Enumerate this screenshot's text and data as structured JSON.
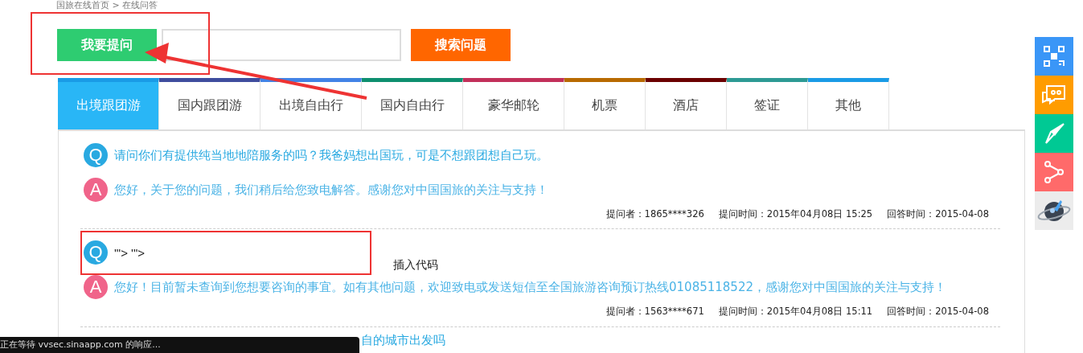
{
  "breadcrumb": "国旅在线首页 > 在线问答",
  "ask_button": "我要提问",
  "search_button": "搜索问题",
  "tabs": [
    {
      "label": "出境跟团游",
      "color": "#1a9be6",
      "selected": true
    },
    {
      "label": "国内跟团游",
      "color": "#3f4d9e",
      "selected": false
    },
    {
      "label": "出境自由行",
      "color": "#4283e6",
      "selected": false
    },
    {
      "label": "国内自由行",
      "color": "#0e8f6f",
      "selected": false
    },
    {
      "label": "豪华邮轮",
      "color": "#c2305a",
      "selected": false
    },
    {
      "label": "机票",
      "color": "#b86a00",
      "selected": false
    },
    {
      "label": "酒店",
      "color": "#6b0000",
      "selected": false
    },
    {
      "label": "签证",
      "color": "#2d9a94",
      "selected": false
    },
    {
      "label": "其他",
      "color": "#1a9be6",
      "selected": false
    }
  ],
  "questions": [
    {
      "q_badge": "Q",
      "question": "请问你们有提供纯当地地陪服务的吗？我爸妈想出国玩，可是不想跟团想自己玩。",
      "a_badge": "A",
      "answer": "您好，关于您的问题，我们稍后给您致电解答。感谢您对中国国旅的关注与支持！",
      "asker": "提问者：1865****326",
      "ask_time": "提问时间：2015年04月08日 15:25",
      "answer_time": "回答时间：2015-04-08"
    },
    {
      "q_badge": "Q",
      "question": "'\"> '\">",
      "a_badge": "A",
      "answer": "您好！目前暂未查询到您想要咨询的事宜。如有其他问题，欢迎致电或发送短信至全国旅游咨询预订热线01085118522，感谢您对中国国旅的关注与支持！",
      "asker": "提问者：1563****671",
      "ask_time": "提问时间：2015年04月08日 15:11",
      "answer_time": "回答时间：2015-04-08"
    },
    {
      "question": "自的城市出发吗"
    }
  ],
  "side_tools": [
    {
      "kind": "qr"
    },
    {
      "kind": "chat"
    },
    {
      "kind": "compass"
    },
    {
      "kind": "share"
    },
    {
      "kind": "rocket"
    }
  ],
  "status_bar": "正在等待 vvsec.sinaapp.com 的响应...",
  "annotation": {
    "label": "插入代码"
  }
}
